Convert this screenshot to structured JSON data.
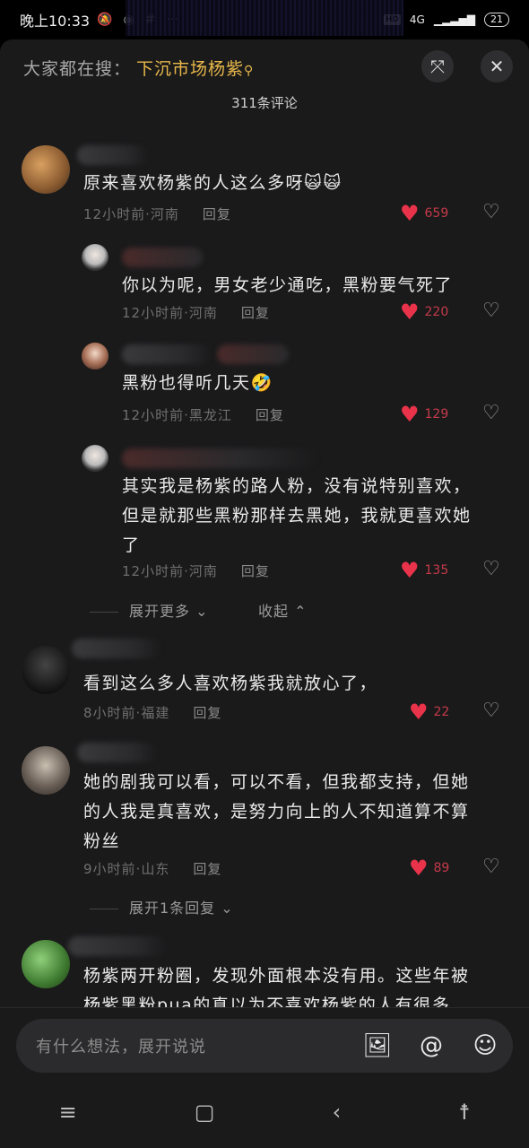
{
  "status": {
    "time": "晚上10:33",
    "battery": "21",
    "network": "4G",
    "hd": "HD"
  },
  "search": {
    "prefix": "大家都在搜：",
    "term": "下沉市场杨紫",
    "term_icon": "search-icon"
  },
  "header": {
    "count": "311条评论",
    "collapse_icon": "collapse-icon",
    "close_icon": "close-icon"
  },
  "comments": [
    {
      "text": "原来喜欢杨紫的人这么多呀",
      "emoji": "🙀🙀",
      "time": "12小时前",
      "place": "河南",
      "reply": "回复",
      "likes": "659"
    },
    {
      "text": "你以为呢，男女老少通吃，黑粉要气死了",
      "time": "12小时前",
      "place": "河南",
      "reply": "回复",
      "likes": "220"
    },
    {
      "text": "黑粉也得听几天",
      "emoji": "🤣",
      "time": "12小时前",
      "place": "黑龙江",
      "reply": "回复",
      "likes": "129"
    },
    {
      "text1": "其实我是杨紫的路人粉，没有说特别喜欢，",
      "text2": "但是就那些黑粉那样去黑她，我就更喜欢她",
      "text3": "了",
      "time": "12小时前",
      "place": "河南",
      "reply": "回复",
      "likes": "135"
    },
    {
      "text": "看到这么多人喜欢杨紫我就放心了，",
      "time": "8小时前",
      "place": "福建",
      "reply": "回复",
      "likes": "22"
    },
    {
      "text1": "她的剧我可以看，可以不看，但我都支持，但她",
      "text2": "的人我是真喜欢，是努力向上的人不知道算不算",
      "text3": "粉丝",
      "time": "9小时前",
      "place": "山东",
      "reply": "回复",
      "likes": "89"
    },
    {
      "text1": "杨紫两开粉圈，发现外面根本没有用。这些年被",
      "text2": "杨紫黑粉pua的真以为不喜欢杨紫的人有很多"
    }
  ],
  "thread": {
    "expand_more": "展开更多",
    "collapse": "收起",
    "expand_replies": "展开1条回复"
  },
  "composer": {
    "placeholder": "有什么想法，展开说说",
    "image_icon": "image-icon",
    "at_icon": "at-icon",
    "emoji_icon": "emoji-icon"
  },
  "colors": {
    "accent": "#e8b84a",
    "like": "#e8334a",
    "sheet": "#1a1a1b"
  }
}
